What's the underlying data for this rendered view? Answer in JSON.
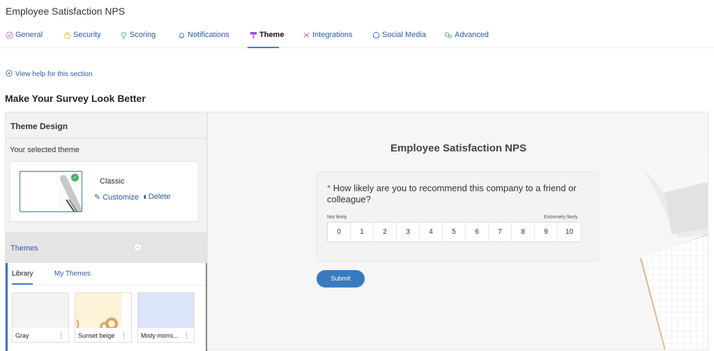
{
  "page": {
    "title": "Employee Satisfaction NPS"
  },
  "tabs": [
    {
      "label": "General",
      "icon": "check-circle-icon",
      "color": "#c86ad8"
    },
    {
      "label": "Security",
      "icon": "lock-icon",
      "color": "#f0b43c"
    },
    {
      "label": "Scoring",
      "icon": "trophy-icon",
      "color": "#2fbf9f"
    },
    {
      "label": "Notifications",
      "icon": "bell-icon",
      "color": "#3a7bd5"
    },
    {
      "label": "Theme",
      "icon": "paint-roller-icon",
      "color": "#a04ad8"
    },
    {
      "label": "Integrations",
      "icon": "puzzle-icon",
      "color": "#e86a9a"
    },
    {
      "label": "Social Media",
      "icon": "social-icon",
      "color": "#3a7bd5"
    },
    {
      "label": "Advanced",
      "icon": "gears-icon",
      "color": "#3cb371"
    }
  ],
  "active_tab": "Theme",
  "help": {
    "label": "View help for this section"
  },
  "section": {
    "title": "Make Your Survey Look Better"
  },
  "theme_design": {
    "header": "Theme Design",
    "selected_label": "Your selected theme",
    "selected": {
      "name": "Classic",
      "customize": "Customize",
      "delete": "Delete"
    },
    "themes_label": "Themes",
    "library_tabs": [
      "Library",
      "My Themes"
    ],
    "cards": [
      {
        "name": "Gray",
        "color": "#f3f3f3"
      },
      {
        "name": "Sunset beige",
        "color": "#fdf3d9"
      },
      {
        "name": "Misty morni...",
        "color": "#dbe4f8"
      }
    ]
  },
  "preview": {
    "survey_title": "Employee Satisfaction NPS",
    "required_mark": "*",
    "question": "How likely are you to recommend this company to a friend or colleague?",
    "scale_low": "Not likely",
    "scale_high": "Extremely likely",
    "scale": [
      "0",
      "1",
      "2",
      "3",
      "4",
      "5",
      "6",
      "7",
      "8",
      "9",
      "10"
    ],
    "submit": "Submit"
  },
  "colors": {
    "accent": "#3a7bd5",
    "link": "#2a5aa0",
    "submit": "#3a7bbf"
  }
}
